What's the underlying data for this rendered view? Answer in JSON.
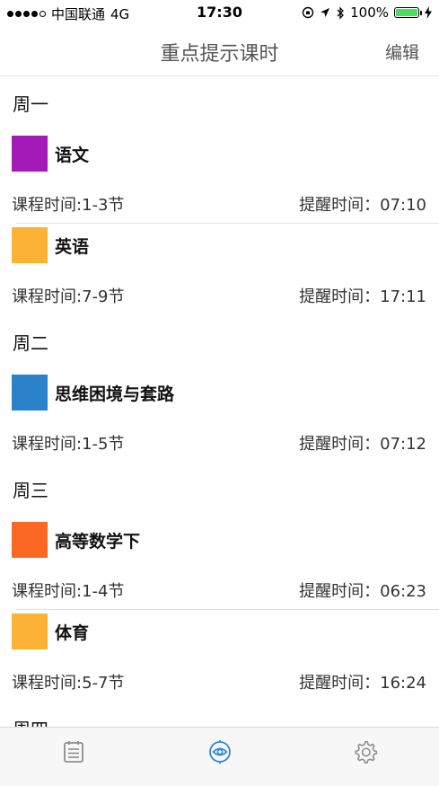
{
  "status_bar": {
    "carrier": "中国联通",
    "network": "4G",
    "time": "17:30",
    "battery": "100%",
    "battery_level": 1.0,
    "battery_color": "#4cd964"
  },
  "nav": {
    "title": "重点提示课时",
    "edit_label": "编辑"
  },
  "schedule": [
    {
      "day": "周一",
      "courses": [
        {
          "name": "语文",
          "color": "#a41ab8",
          "course_time": "课程时间:1-3节",
          "remind_time": "提醒时间：07:10"
        },
        {
          "name": "英语",
          "color": "#fcb234",
          "course_time": "课程时间:7-9节",
          "remind_time": "提醒时间：17:11"
        }
      ]
    },
    {
      "day": "周二",
      "courses": [
        {
          "name": "思维困境与套路",
          "color": "#2a82ca",
          "course_time": "课程时间:1-5节",
          "remind_time": "提醒时间：07:12"
        }
      ]
    },
    {
      "day": "周三",
      "courses": [
        {
          "name": "高等数学下",
          "color": "#fa6824",
          "course_time": "课程时间:1-4节",
          "remind_time": "提醒时间：06:23"
        },
        {
          "name": "体育",
          "color": "#fcb234",
          "course_time": "课程时间:5-7节",
          "remind_time": "提醒时间：16:24"
        }
      ]
    },
    {
      "day": "周四",
      "courses": []
    }
  ],
  "tab_bar": {
    "tabs": [
      {
        "icon": "schedule-list-icon",
        "active": false
      },
      {
        "icon": "reminder-target-icon",
        "active": true
      },
      {
        "icon": "settings-gear-icon",
        "active": false
      }
    ],
    "active_color": "#2f86d6",
    "inactive_color": "#8e8e8e"
  }
}
